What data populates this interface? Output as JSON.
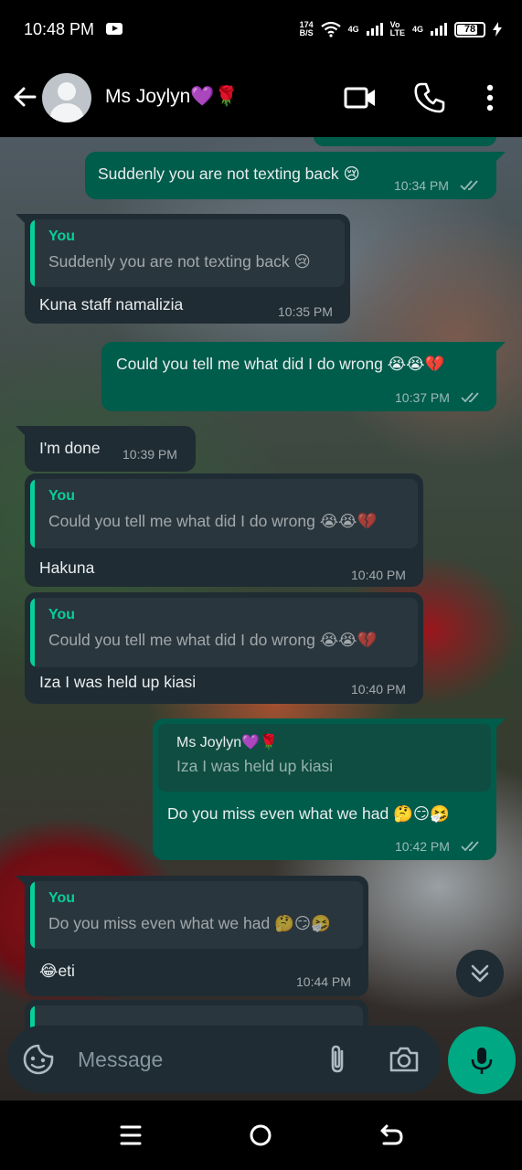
{
  "status_bar": {
    "time": "10:48 PM",
    "speed_value": "174",
    "speed_unit": "B/S",
    "net1": "4G",
    "volte_top": "Vo",
    "volte_bottom": "LTE",
    "net2": "4G",
    "battery": "78"
  },
  "header": {
    "contact_name": "Ms Joylyn💜🌹"
  },
  "messages": [
    {
      "id": "m0",
      "direction": "out",
      "text": "Suddenly you are not texting back 😢",
      "time": "10:34 PM",
      "read": true
    },
    {
      "id": "m1",
      "direction": "in",
      "quote_author": "You",
      "quote_text": "Suddenly you are not texting back 😢",
      "text": "Kuna staff namalizia",
      "time": "10:35 PM"
    },
    {
      "id": "m2",
      "direction": "out",
      "text": "Could you tell me what did I do wrong 😭😭💔",
      "time": "10:37 PM",
      "read": true
    },
    {
      "id": "m3",
      "direction": "in",
      "text": "I'm done",
      "time": "10:39 PM"
    },
    {
      "id": "m4",
      "direction": "in",
      "quote_author": "You",
      "quote_text": "Could you tell me what did I do wrong 😭😭💔",
      "text": "Hakuna",
      "time": "10:40 PM"
    },
    {
      "id": "m5",
      "direction": "in",
      "quote_author": "You",
      "quote_text": "Could you tell me what did I do wrong 😭😭💔",
      "text": "Iza I was held up kiasi",
      "time": "10:40 PM"
    },
    {
      "id": "m6",
      "direction": "out",
      "quote_author": "Ms Joylyn💜🌹",
      "quote_text": "Iza I was held up kiasi",
      "text": "Do you miss even what we had 🤔😏🤧",
      "time": "10:42 PM",
      "read": true
    },
    {
      "id": "m7",
      "direction": "in",
      "quote_author": "You",
      "quote_text": "Do you miss even what we had 🤔😏🤧",
      "text": "😂eti",
      "time": "10:44 PM"
    }
  ],
  "input": {
    "placeholder": "Message"
  },
  "icons": {
    "back": "back-arrow-icon",
    "video": "video-call-icon",
    "call": "phone-icon",
    "menu": "more-vertical-icon",
    "sticker": "sticker-icon",
    "attach": "paperclip-icon",
    "camera": "camera-icon",
    "mic": "mic-icon",
    "scroll": "double-chevron-down-icon"
  },
  "colors": {
    "incoming_bubble": "#1f2c33",
    "outgoing_bubble": "#005c4b",
    "accent": "#00a884",
    "quote_author": "#06cf9c"
  }
}
